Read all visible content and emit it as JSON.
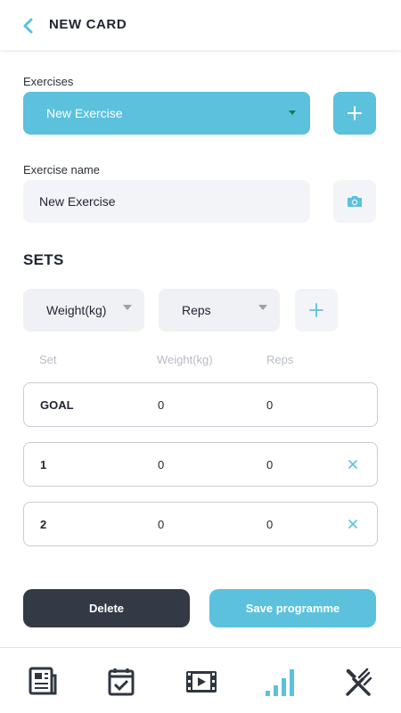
{
  "header": {
    "title": "NEW CARD",
    "back_icon": "chevron-left-icon"
  },
  "exercises": {
    "label": "Exercises",
    "selected": "New Exercise",
    "add_icon": "plus-icon"
  },
  "exercise_name": {
    "label": "Exercise name",
    "value": "New Exercise",
    "camera_icon": "camera-icon"
  },
  "sets": {
    "title": "SETS",
    "weight_select": "Weight(kg)",
    "reps_select": "Reps",
    "add_icon": "plus-icon",
    "columns": {
      "set": "Set",
      "weight": "Weight(kg)",
      "reps": "Reps"
    },
    "rows": [
      {
        "name": "GOAL",
        "weight": "0",
        "reps": "0"
      },
      {
        "name": "1",
        "weight": "0",
        "reps": "0"
      },
      {
        "name": "2",
        "weight": "0",
        "reps": "0"
      }
    ]
  },
  "actions": {
    "delete": "Delete",
    "save": "Save programme"
  },
  "bottom_nav": [
    "newspaper-icon",
    "calendar-check-icon",
    "video-icon",
    "bar-chart-icon",
    "fork-knife-icon"
  ],
  "colors": {
    "accent": "#5bc1dd",
    "dark": "#343a45",
    "field": "#f3f4f8",
    "active_nav": "#5bc1dd"
  }
}
